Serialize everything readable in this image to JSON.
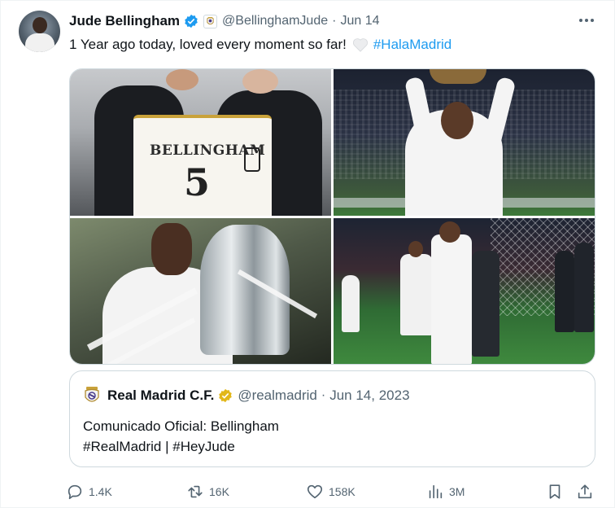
{
  "author": {
    "name": "Jude Bellingham",
    "handle": "@BellinghamJude",
    "separator": "·",
    "date": "Jun 14"
  },
  "tweet": {
    "text": "1 Year ago today, loved every moment so far!",
    "hashtag": "#HalaMadrid"
  },
  "media": {
    "photo1": {
      "jersey_name": "BELLINGHAM",
      "jersey_number": "5"
    }
  },
  "quoted_tweet": {
    "name": "Real Madrid C.F.",
    "handle": "@realmadrid",
    "separator": "·",
    "date": "Jun 14, 2023",
    "line1": "Comunicado Oficial: Bellingham",
    "line2": "#RealMadrid | #HeyJude"
  },
  "actions": {
    "replies": "1.4K",
    "reposts": "16K",
    "likes": "158K",
    "views": "3M"
  },
  "colors": {
    "text": "#0f1419",
    "muted": "#536471",
    "link": "#1d9bf0",
    "border": "#cfd9de",
    "verified_blue": "#1d9bf0",
    "verified_gold": "#e2b719"
  },
  "icons": [
    "verified-badge-icon",
    "real-madrid-crest-icon",
    "more-icon",
    "white-heart-emoji",
    "reply-icon",
    "repost-icon",
    "like-icon",
    "views-icon",
    "bookmark-icon",
    "share-icon",
    "gold-verified-badge-icon"
  ]
}
